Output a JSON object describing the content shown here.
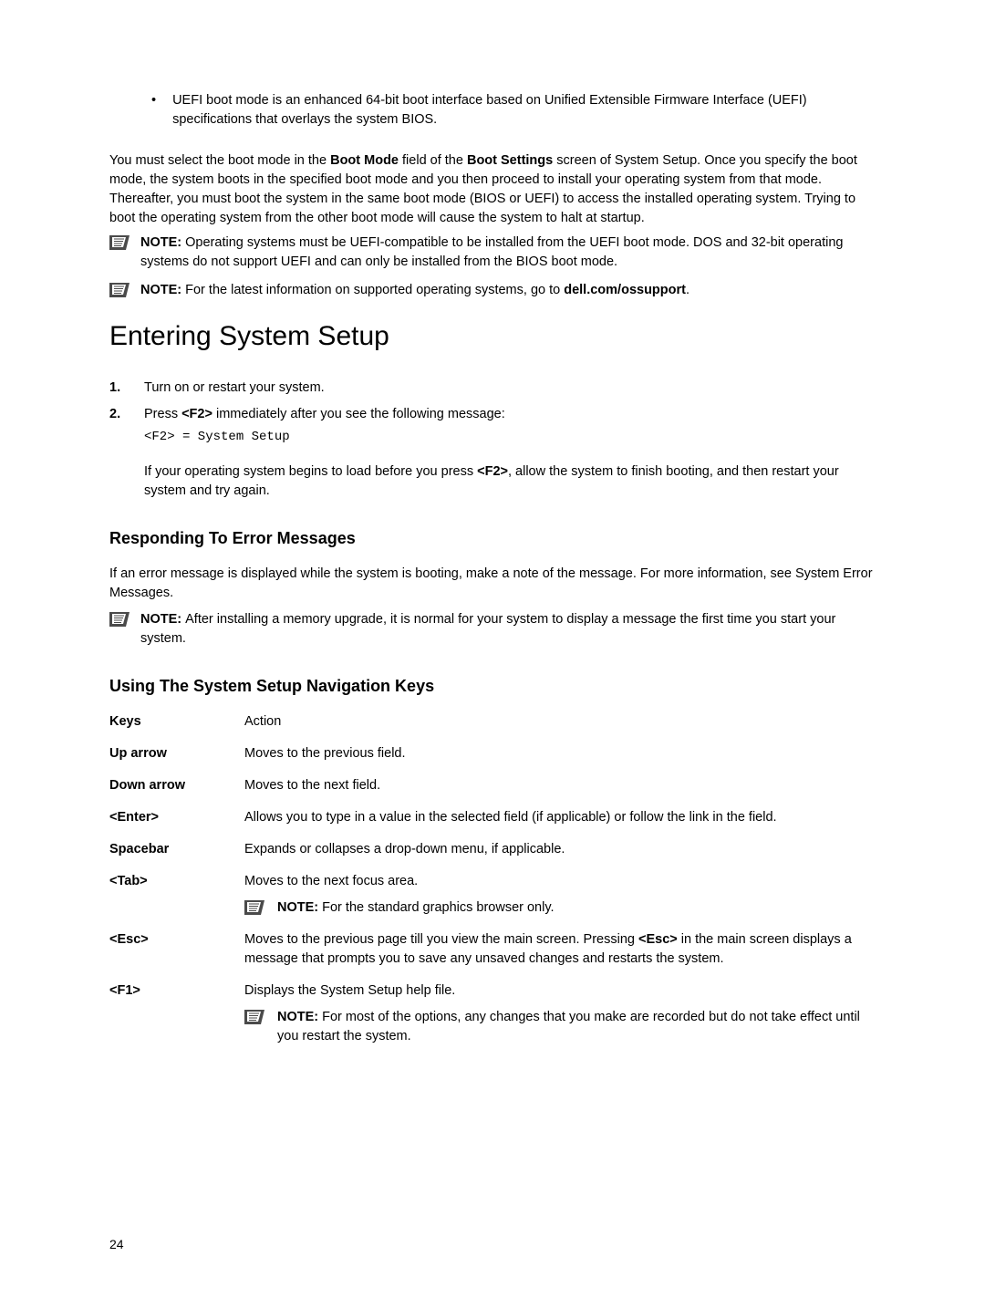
{
  "bullet1": "UEFI boot mode is an enhanced 64-bit boot interface based on Unified Extensible Firmware Interface (UEFI) specifications that overlays the system BIOS.",
  "para1_pre": "You must select the boot mode in the ",
  "para1_b1": "Boot Mode",
  "para1_mid1": " field of the ",
  "para1_b2": "Boot Settings",
  "para1_post": " screen of System Setup. Once you specify the boot mode, the system boots in the specified boot mode and you then proceed to install your operating system from that mode. Thereafter, you must boot the system in the same boot mode (BIOS or UEFI) to access the installed operating system. Trying to boot the operating system from the other boot mode will cause the system to halt at startup.",
  "note1_label": "NOTE: ",
  "note1_text": "Operating systems must be UEFI-compatible to be installed from the UEFI boot mode. DOS and 32-bit operating systems do not support UEFI and can only be installed from the BIOS boot mode.",
  "note2_label": "NOTE: ",
  "note2_pre": "For the latest information on supported operating systems, go to ",
  "note2_b": "dell.com/ossupport",
  "note2_post": ".",
  "h1": "Entering System Setup",
  "step1_num": "1.",
  "step1_text": "Turn on or restart your system.",
  "step2_num": "2.",
  "step2_pre": "Press ",
  "step2_b": "<F2>",
  "step2_post": " immediately after you see the following message:",
  "step2_code": "<F2> = System Setup",
  "step2_sub_pre": "If your operating system begins to load before you press ",
  "step2_sub_b": "<F2>",
  "step2_sub_post": ", allow the system to finish booting, and then restart your system and try again.",
  "h2a": "Responding To Error Messages",
  "para2": "If an error message is displayed while the system is booting, make a note of the message. For more information, see System Error Messages.",
  "note3_label": "NOTE: ",
  "note3_text": "After installing a memory upgrade, it is normal for your system to display a message the first time you start your system.",
  "h2b": "Using The System Setup Navigation Keys",
  "table": {
    "header_key": "Keys",
    "header_val": "Action",
    "rows": [
      {
        "key": "Up arrow",
        "val": "Moves to the previous field."
      },
      {
        "key": "Down arrow",
        "val": "Moves to the next field."
      },
      {
        "key": "<Enter>",
        "val": "Allows you to type in a value in the selected field (if applicable) or follow the link in the field."
      },
      {
        "key": "Spacebar",
        "val": "Expands or collapses a drop-down menu, if applicable."
      }
    ],
    "tab_key": "<Tab>",
    "tab_val": "Moves to the next focus area.",
    "tab_note_label": "NOTE: ",
    "tab_note_text": "For the standard graphics browser only.",
    "esc_key": "<Esc>",
    "esc_pre": "Moves to the previous page till you view the main screen. Pressing ",
    "esc_b": "<Esc>",
    "esc_post": " in the main screen displays a message that prompts you to save any unsaved changes and restarts the system.",
    "f1_key": "<F1>",
    "f1_val": "Displays the System Setup help file.",
    "f1_note_label": "NOTE: ",
    "f1_note_text": "For most of the options, any changes that you make are recorded but do not take effect until you restart the system."
  },
  "page_num": "24"
}
